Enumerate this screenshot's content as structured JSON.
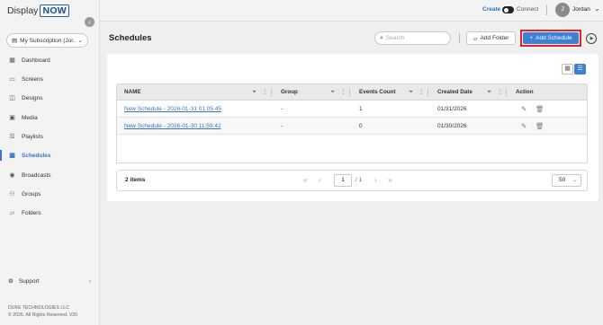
{
  "brand": {
    "word1": "Display",
    "word2": "NOW"
  },
  "sidebar": {
    "subscription": "My Subscription (Jor...",
    "items": [
      {
        "label": "Dashboard",
        "icon": "dashboard-icon"
      },
      {
        "label": "Screens",
        "icon": "screens-icon"
      },
      {
        "label": "Designs",
        "icon": "designs-icon"
      },
      {
        "label": "Media",
        "icon": "media-icon"
      },
      {
        "label": "Playlists",
        "icon": "playlists-icon"
      },
      {
        "label": "Schedules",
        "icon": "schedules-icon",
        "active": true
      },
      {
        "label": "Broadcasts",
        "icon": "broadcasts-icon"
      },
      {
        "label": "Groups",
        "icon": "groups-icon"
      },
      {
        "label": "Folders",
        "icon": "folders-icon"
      }
    ],
    "support": "Support",
    "footer_company": "DUKE TECHNOLOGIES LLC",
    "footer_copyright": "© 2026. All Rights Reserved. V26"
  },
  "topbar": {
    "create": "Create",
    "connect": "Connect",
    "avatar_initial": "J",
    "user_name": "Jordan"
  },
  "main": {
    "title": "Schedules",
    "search_placeholder": "Search",
    "add_folder": "Add Folder",
    "add_schedule": "Add Schedule"
  },
  "table": {
    "columns": [
      "NAME",
      "Group",
      "Events Count",
      "Created Date",
      "Action"
    ],
    "rows": [
      {
        "name": "New Schedule - 2026-01-31 01:05:45",
        "group": "-",
        "events": "1",
        "created": "01/31/2026"
      },
      {
        "name": "New Schedule - 2026-01-30 11:59:42",
        "group": "-",
        "events": "0",
        "created": "01/30/2026"
      }
    ]
  },
  "pagination": {
    "items": "2 items",
    "page": "1",
    "total": "/ 1",
    "page_size": "50"
  },
  "colors": {
    "accent": "#3f7fd6",
    "highlight_border": "#e02424"
  }
}
